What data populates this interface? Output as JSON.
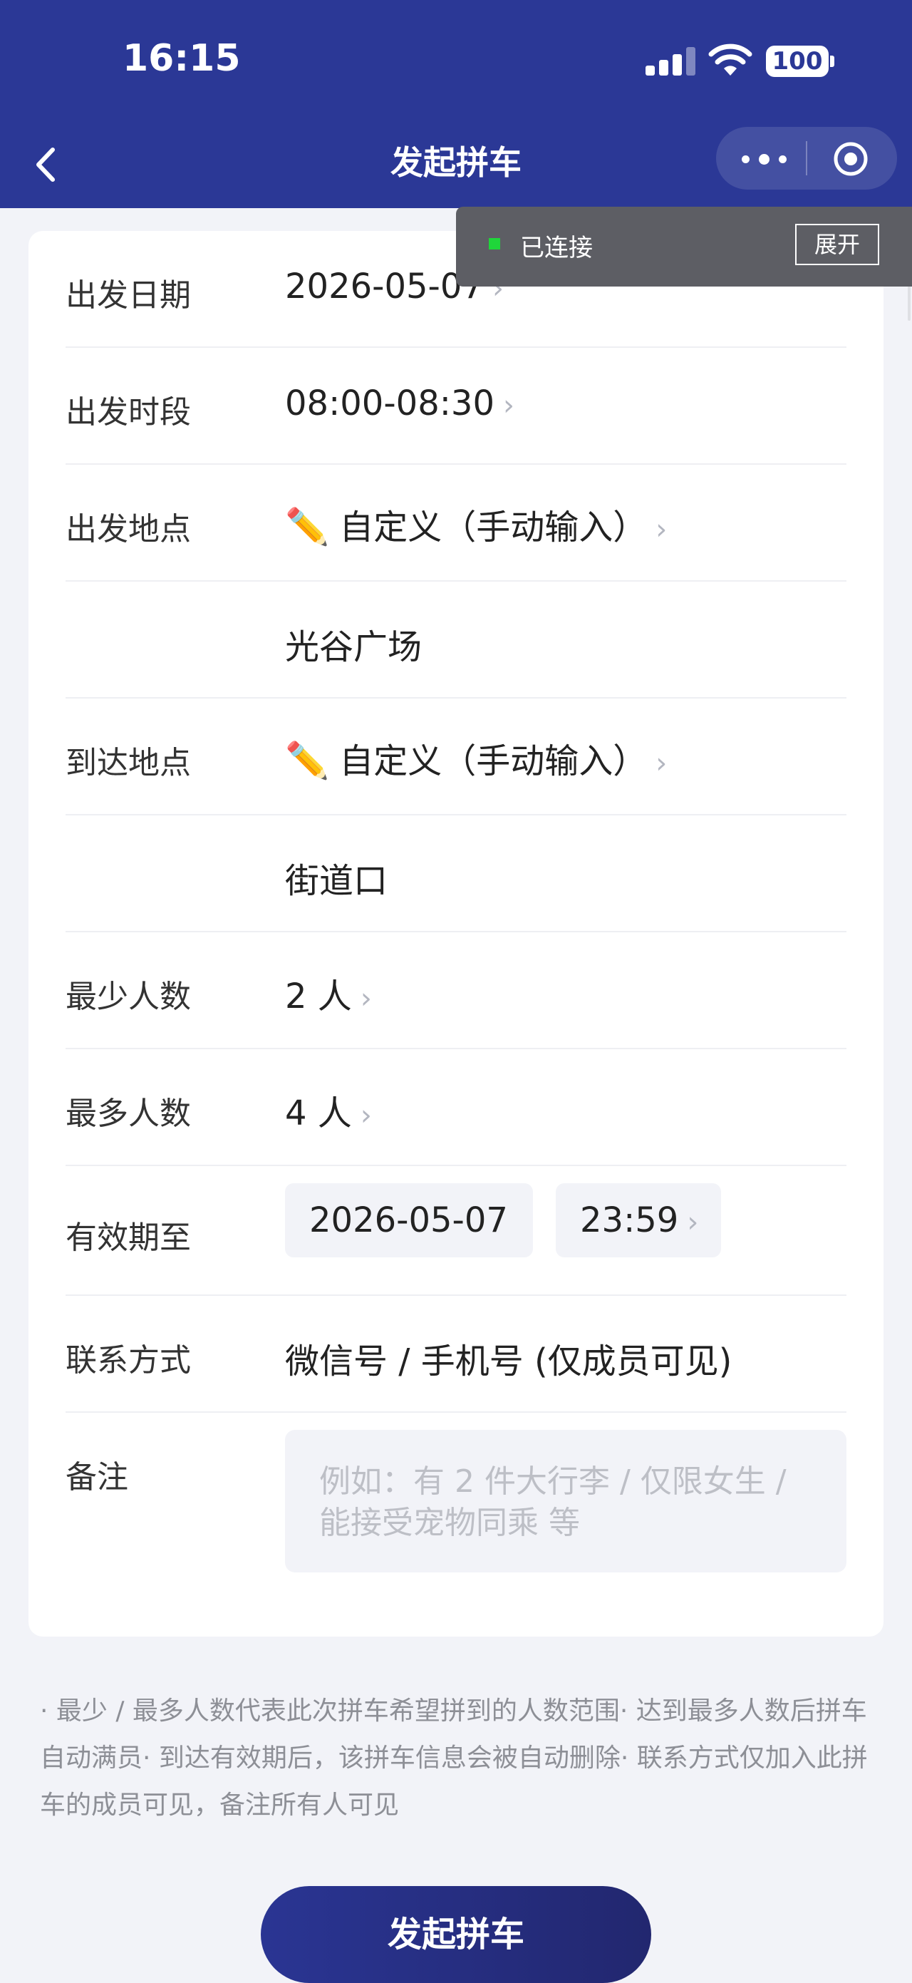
{
  "status_bar": {
    "time": "16:15",
    "battery": "100"
  },
  "nav": {
    "title": "发起拼车"
  },
  "toast": {
    "status": "已连接",
    "expand_label": "展开"
  },
  "form": {
    "date": {
      "label": "出发日期",
      "value": "2026-05-07"
    },
    "time_slot": {
      "label": "出发时段",
      "value": "08:00-08:30"
    },
    "departure": {
      "label": "出发地点",
      "mode": "自定义（手动输入）",
      "text": "光谷广场"
    },
    "arrival": {
      "label": "到达地点",
      "mode": "自定义（手动输入）",
      "text": "街道口"
    },
    "min_people": {
      "label": "最少人数",
      "value": "2 人"
    },
    "max_people": {
      "label": "最多人数",
      "value": "4 人"
    },
    "valid_until": {
      "label": "有效期至",
      "date": "2026-05-07",
      "time": "23:59"
    },
    "contact": {
      "label": "联系方式",
      "placeholder": "微信号 / 手机号 (仅成员可见)"
    },
    "note": {
      "label": "备注",
      "placeholder": "例如：有 2 件大行李 / 仅限女生 / 能接受宠物同乘 等"
    }
  },
  "hint": "· 最少 / 最多人数代表此次拼车希望拼到的人数范围· 达到最多人数后拼车自动满员· 到达有效期后，该拼车信息会被自动删除· 联系方式仅加入此拼车的成员可见，备注所有人可见",
  "submit_label": "发起拼车",
  "icons": {
    "chevron": "›",
    "pencil": "✏️"
  }
}
